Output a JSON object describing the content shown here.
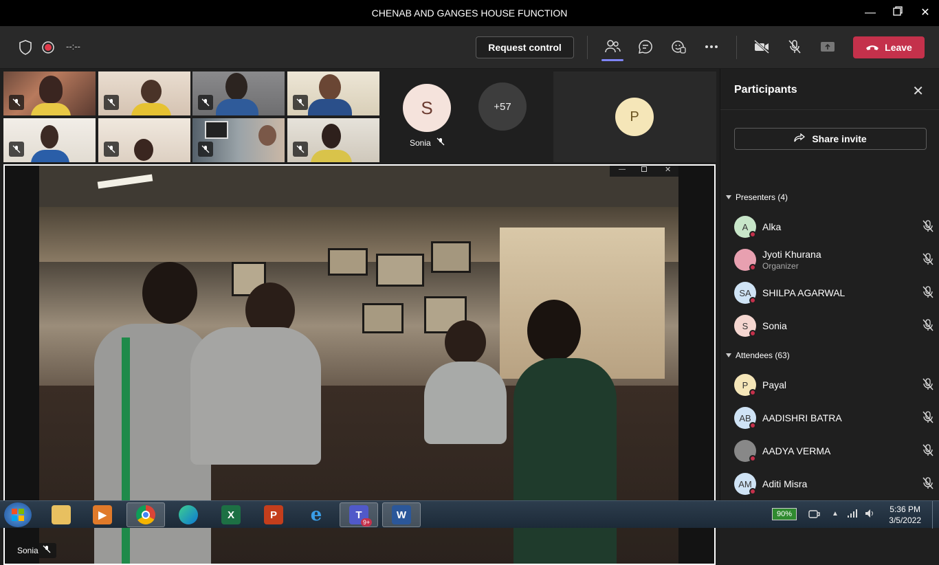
{
  "window": {
    "title": "CHENAB AND GANGES HOUSE FUNCTION"
  },
  "toolbar": {
    "timer": "--:--",
    "request_control": "Request control",
    "leave": "Leave"
  },
  "gallery": {
    "sonia_initial": "S",
    "sonia_name": "Sonia",
    "overflow_count": "+57",
    "p_initial": "P"
  },
  "share": {
    "presenter": "Sonia"
  },
  "participants": {
    "title": "Participants",
    "share_invite": "Share invite",
    "presenters_label": "Presenters (4)",
    "attendees_label": "Attendees (63)",
    "presenters": [
      {
        "initials": "A",
        "name": "Alka",
        "role": "",
        "color": "#c8e6c9"
      },
      {
        "initials": "",
        "name": "Jyoti Khurana",
        "role": "Organizer",
        "color": "#e8a0b0"
      },
      {
        "initials": "SA",
        "name": "SHILPA AGARWAL",
        "role": "",
        "color": "#cfe3f5"
      },
      {
        "initials": "S",
        "name": "Sonia",
        "role": "",
        "color": "#f5d6d0"
      }
    ],
    "attendees": [
      {
        "initials": "P",
        "name": "Payal",
        "color": "#f5e6b8"
      },
      {
        "initials": "AB",
        "name": "AADISHRI BATRA",
        "color": "#cfe3f5"
      },
      {
        "initials": "",
        "name": "AADYA VERMA",
        "color": "#888888"
      },
      {
        "initials": "AM",
        "name": "Aditi Misra",
        "color": "#cfe3f5"
      }
    ]
  },
  "taskbar": {
    "battery": "90%",
    "time": "5:36 PM",
    "date": "3/5/2022",
    "teams_badge": "9+"
  }
}
